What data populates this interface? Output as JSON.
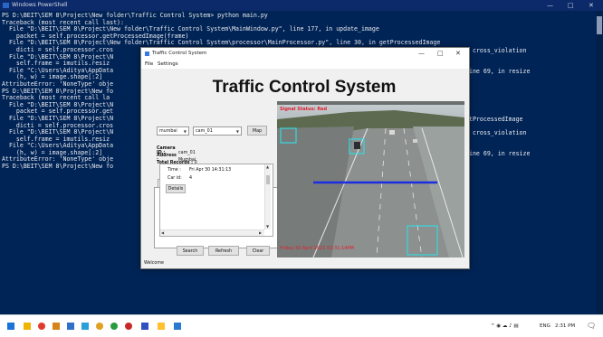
{
  "powershell": {
    "title": "Windows PowerShell",
    "controls": {
      "minimize": "—",
      "maximize": "□",
      "close": "✕"
    },
    "lines": [
      "PS D:\\BEIT\\SEM 8\\Project\\New folder\\Traffic Control System> python main.py",
      "Traceback (most recent call last):",
      "  File \"D:\\BEIT\\SEM 8\\Project\\New folder\\Traffic Control System\\MainWindow.py\", line 177, in update_image",
      "    packet = self.processor.getProcessedImage(frame)",
      "  File \"D:\\BEIT\\SEM 8\\Project\\New folder\\Traffic Control System\\processor\\MainProcessor.py\", line 30, in getProcessedImage",
      "    dicti = self.processor.cros",
      "  File \"D:\\BEIT\\SEM 8\\Project\\N",
      "    self.frame = imutils.resiz",
      "  File \"C:\\Users\\Aditya\\AppData",
      "    (h, w) = image.shape[:2]",
      "AttributeError: 'NoneType' obje",
      "PS D:\\BEIT\\SEM 8\\Project\\New fo",
      "Traceback (most recent call la",
      "  File \"D:\\BEIT\\SEM 8\\Project\\N",
      "    packet = self.processor.get",
      "  File \"D:\\BEIT\\SEM 8\\Project\\N",
      "    dicti = self.processor.cros",
      "  File \"D:\\BEIT\\SEM 8\\Project\\N",
      "    self.frame = imutils.resiz",
      "  File \"C:\\Users\\Aditya\\AppData",
      "    (h, w) = image.shape[:2]",
      "AttributeError: 'NoneType' obje",
      "PS D:\\BEIT\\SEM 8\\Project\\New fo"
    ],
    "right_fragments": [
      {
        "text": "n cross_violation",
        "row": 5
      },
      {
        "text": "line 69, in resize",
        "row": 8
      },
      {
        "text": "etProcessedImage",
        "row": 15
      },
      {
        "text": "n cross_violation",
        "row": 17
      },
      {
        "text": "line 69, in resize",
        "row": 20
      }
    ]
  },
  "app": {
    "window_title": "Traffic Control System",
    "controls": {
      "minimize": "—",
      "maximize": "□",
      "close": "✕"
    },
    "menu": {
      "file": "File",
      "settings": "Settings"
    },
    "heading": "Traffic Control System",
    "city_select": {
      "value": "mumbai"
    },
    "camera_select": {
      "value": "cam_01"
    },
    "map_button": "Map",
    "info": {
      "camera_id_label": "Camera ID :",
      "camera_id_value": "cam_01",
      "address_label": "Address :",
      "address_value": "Mumbai",
      "total_label": "Total Records :",
      "total_value": "0"
    },
    "tabs": {
      "violations": "Violations",
      "search_result": "Search Result"
    },
    "record": {
      "time_label": "Time :",
      "time_value": "Fri Apr 30 14:31:13",
      "car_label": "Car id:",
      "car_value": "4",
      "details_button": "Details"
    },
    "buttons": {
      "search": "Search",
      "refresh": "Refresh",
      "clear": "Clear"
    },
    "status": "Welcome",
    "video": {
      "signal_text": "Signal Status: Red",
      "timestamp_text": "Friday 30 April 2021 02:31:14PM",
      "overlay_color": "#e0202e",
      "box_color": "#35d8e0",
      "line_color": "#1a2ee0"
    }
  },
  "taskbar": {
    "tray_lang": "ENG",
    "clock": "2:31 PM"
  }
}
